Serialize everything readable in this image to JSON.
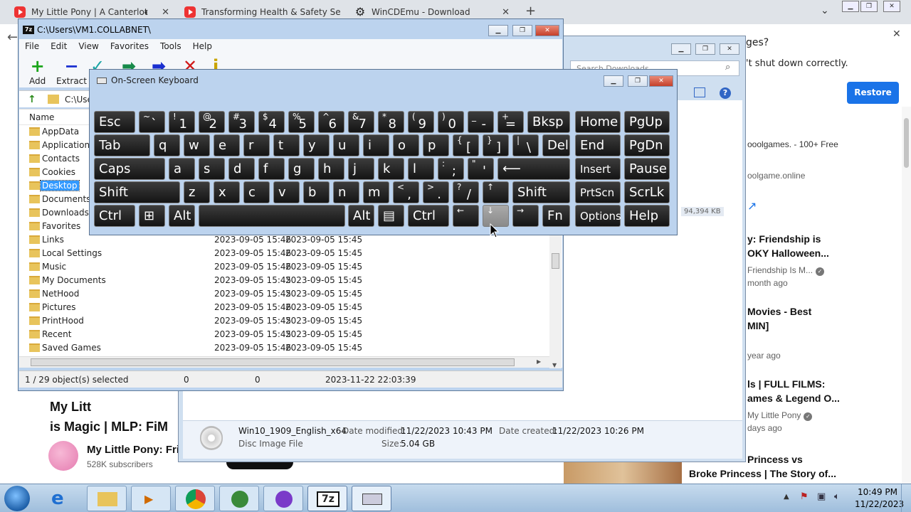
{
  "browser": {
    "tabs": [
      {
        "label": "My Little Pony | A Canterlot",
        "icon": "youtube-icon",
        "has_audio": true
      },
      {
        "label": "Transforming Health & Safety Se",
        "icon": "youtube-icon"
      },
      {
        "label": "WinCDEmu - Download",
        "icon": "gear-icon"
      }
    ],
    "new_tab": "+",
    "notification": {
      "question_tail": "ges?",
      "message_tail": "'t shut down correctly.",
      "restore_label": "Restore"
    }
  },
  "youtube_main": {
    "title_line1": "My Litt",
    "title_line2": "is Magic | MLP: FiM",
    "channel": "My Little Pony: Fri",
    "subscribers": "528K subscribers"
  },
  "youtube_sidebar": [
    {
      "title": "ooolgames. - 100+ Free",
      "subtitle": "oolgame.online"
    },
    {
      "title": "y: Friendship is",
      "title2": "OKY Halloween...",
      "channel": "Friendship Is M...",
      "age": "month ago"
    },
    {
      "title": "Movies - Best",
      "title2": "MIN]",
      "age": "year ago"
    },
    {
      "title": "ls | FULL FILMS:",
      "title2": "ames & Legend O...",
      "channel": "My Little Pony",
      "age": "days ago"
    },
    {
      "title": "Princess vs",
      "title2": "Broke Princess | The Story of..."
    }
  ],
  "downloads_window": {
    "search_placeholder": "Search Downloads",
    "size_badge": "94,394 KB",
    "file": {
      "name": "Win10_1909_English_x64",
      "type": "Disc Image File",
      "date_modified_label": "Date modified:",
      "date_modified": "11/22/2023 10:43 PM",
      "date_created_label": "Date created:",
      "date_created": "11/22/2023 10:26 PM",
      "size_label": "Size:",
      "size": "5.04 GB"
    }
  },
  "sevenzip": {
    "title": "C:\\Users\\VM1.COLLABNET\\",
    "menu": [
      "File",
      "Edit",
      "View",
      "Favorites",
      "Tools",
      "Help"
    ],
    "toolbar": [
      {
        "label": "Add",
        "icon": "plus-icon",
        "color": "#1aa51a"
      },
      {
        "label": "Extract",
        "icon": "minus-icon",
        "color": "#1a2fd0"
      }
    ],
    "address": "C:\\Use",
    "column_name": "Name",
    "rows": [
      {
        "name": "AppData",
        "modified": "",
        "created": ""
      },
      {
        "name": "Application D",
        "modified": "",
        "created": ""
      },
      {
        "name": "Contacts",
        "modified": "",
        "created": ""
      },
      {
        "name": "Cookies",
        "modified": "",
        "created": ""
      },
      {
        "name": "Desktop",
        "modified": "",
        "created": "",
        "selected": true
      },
      {
        "name": "Documents",
        "modified": "",
        "created": ""
      },
      {
        "name": "Downloads",
        "modified": "",
        "created": ""
      },
      {
        "name": "Favorites",
        "modified": "",
        "created": ""
      },
      {
        "name": "Links",
        "modified": "2023-09-05 15:46",
        "created": "2023-09-05 15:45"
      },
      {
        "name": "Local Settings",
        "modified": "2023-09-05 15:46",
        "created": "2023-09-05 15:45"
      },
      {
        "name": "Music",
        "modified": "2023-09-05 15:46",
        "created": "2023-09-05 15:45"
      },
      {
        "name": "My Documents",
        "modified": "2023-09-05 15:45",
        "created": "2023-09-05 15:45"
      },
      {
        "name": "NetHood",
        "modified": "2023-09-05 15:45",
        "created": "2023-09-05 15:45"
      },
      {
        "name": "Pictures",
        "modified": "2023-09-05 15:46",
        "created": "2023-09-05 15:45"
      },
      {
        "name": "PrintHood",
        "modified": "2023-09-05 15:45",
        "created": "2023-09-05 15:45"
      },
      {
        "name": "Recent",
        "modified": "2023-09-05 15:45",
        "created": "2023-09-05 15:45"
      },
      {
        "name": "Saved Games",
        "modified": "2023-09-05 15:46",
        "created": "2023-09-05 15:45"
      }
    ],
    "status": {
      "selection": "1 / 29 object(s) selected",
      "size": "0",
      "packed": "0",
      "datetime": "2023-11-22 22:03:39"
    }
  },
  "osk": {
    "title": "On-Screen Keyboard",
    "rows": [
      [
        {
          "m": "Esc"
        },
        {
          "u": "~",
          "l": "`"
        },
        {
          "u": "!",
          "l": "1"
        },
        {
          "u": "@",
          "l": "2"
        },
        {
          "u": "#",
          "l": "3"
        },
        {
          "u": "$",
          "l": "4"
        },
        {
          "u": "%",
          "l": "5"
        },
        {
          "u": "^",
          "l": "6"
        },
        {
          "u": "&",
          "l": "7"
        },
        {
          "u": "*",
          "l": "8"
        },
        {
          "u": "(",
          "l": "9"
        },
        {
          "u": ")",
          "l": "0"
        },
        {
          "u": "_",
          "l": "-"
        },
        {
          "u": "+",
          "l": "="
        },
        {
          "m": "Bksp"
        },
        {
          "m": "Home"
        },
        {
          "m": "PgUp"
        }
      ],
      [
        {
          "m": "Tab"
        },
        {
          "m": "q"
        },
        {
          "m": "w"
        },
        {
          "m": "e"
        },
        {
          "m": "r"
        },
        {
          "m": "t"
        },
        {
          "m": "y"
        },
        {
          "m": "u"
        },
        {
          "m": "i"
        },
        {
          "m": "o"
        },
        {
          "m": "p"
        },
        {
          "u": "{",
          "l": "["
        },
        {
          "u": "}",
          "l": "]"
        },
        {
          "u": "|",
          "l": "\\"
        },
        {
          "m": "Del"
        },
        {
          "m": "End"
        },
        {
          "m": "PgDn"
        }
      ],
      [
        {
          "m": "Caps"
        },
        {
          "m": "a"
        },
        {
          "m": "s"
        },
        {
          "m": "d"
        },
        {
          "m": "f"
        },
        {
          "m": "g"
        },
        {
          "m": "h"
        },
        {
          "m": "j"
        },
        {
          "m": "k"
        },
        {
          "m": "l"
        },
        {
          "u": ":",
          "l": ";"
        },
        {
          "u": "\"",
          "l": "'"
        },
        {
          "m": "⟵"
        },
        {
          "m": "Insert"
        },
        {
          "m": "Pause"
        }
      ],
      [
        {
          "m": "Shift"
        },
        {
          "m": "z"
        },
        {
          "m": "x"
        },
        {
          "m": "c"
        },
        {
          "m": "v"
        },
        {
          "m": "b"
        },
        {
          "m": "n"
        },
        {
          "m": "m"
        },
        {
          "u": "<",
          "l": ","
        },
        {
          "u": ">",
          "l": "."
        },
        {
          "u": "?",
          "l": "/"
        },
        {
          "u": "↑",
          "l": ""
        },
        {
          "m": "Shift"
        },
        {
          "m": "PrtScn"
        },
        {
          "m": "ScrLk"
        }
      ],
      [
        {
          "m": "Ctrl"
        },
        {
          "m": "⊞"
        },
        {
          "m": "Alt"
        },
        {
          "m": ""
        },
        {
          "m": "Alt"
        },
        {
          "m": "▤"
        },
        {
          "m": "Ctrl"
        },
        {
          "u": "←",
          "l": ""
        },
        {
          "u": "↓",
          "l": "",
          "pressed": true
        },
        {
          "u": "→",
          "l": ""
        },
        {
          "m": "Fn"
        },
        {
          "m": "Options"
        },
        {
          "m": "Help"
        }
      ]
    ]
  },
  "taskbar": {
    "time": "10:49 PM",
    "date": "11/22/2023",
    "apps": [
      "internet-explorer",
      "file-explorer",
      "media-player",
      "chrome",
      "network-app",
      "other-app",
      "7zip",
      "on-screen-keyboard"
    ],
    "badge_7z": "7z"
  }
}
